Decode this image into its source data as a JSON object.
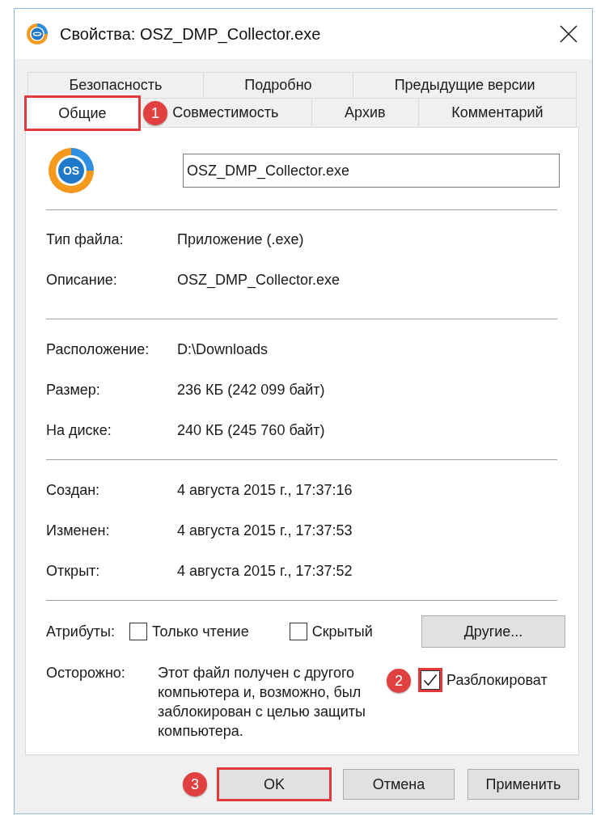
{
  "window": {
    "title": "Свойства: OSZ_DMP_Collector.exe"
  },
  "tab_rows": [
    [
      {
        "label": "Безопасность",
        "selected": false,
        "highlighted": false
      },
      {
        "label": "Подробно",
        "selected": false,
        "highlighted": false
      },
      {
        "label": "Предыдущие версии",
        "selected": false,
        "highlighted": false
      }
    ],
    [
      {
        "label": "Общие",
        "selected": true,
        "highlighted": true,
        "marker": "1"
      },
      {
        "label": "Совместимость",
        "selected": false,
        "highlighted": false
      },
      {
        "label": "Архив",
        "selected": false,
        "highlighted": false
      },
      {
        "label": "Комментарий",
        "selected": false,
        "highlighted": false
      }
    ]
  ],
  "header": {
    "icon_text": "OS",
    "file_name": "OSZ_DMP_Collector.exe"
  },
  "details": [
    [
      {
        "label": "Тип файла:",
        "value": "Приложение (.exe)"
      },
      {
        "label": "Описание:",
        "value": "OSZ_DMP_Collector.exe"
      }
    ],
    [
      {
        "label": "Расположение:",
        "value": "D:\\Downloads"
      },
      {
        "label": "Размер:",
        "value": "236 КБ (242 099 байт)"
      },
      {
        "label": "На диске:",
        "value": "240 КБ (245 760 байт)"
      }
    ],
    [
      {
        "label": "Создан:",
        "value": "4 августа 2015 г., 17:37:16"
      },
      {
        "label": "Изменен:",
        "value": "4 августа 2015 г., 17:37:53"
      },
      {
        "label": "Открыт:",
        "value": "4 августа 2015 г., 17:37:52"
      }
    ]
  ],
  "attributes": {
    "label": "Атрибуты:",
    "checkboxes": [
      {
        "label": "Только чтение",
        "checked": false
      },
      {
        "label": "Скрытый",
        "checked": false
      }
    ],
    "button": "Другие..."
  },
  "warning": {
    "label": "Осторожно:",
    "text": "Этот файл получен с другого компьютера и, возможно, был заблокирован с целью защиты компьютера.",
    "unblock": {
      "label": "Разблокироват",
      "checked": true,
      "highlighted": true,
      "marker": "2"
    }
  },
  "buttons": [
    {
      "label": "OK",
      "highlighted": true,
      "marker": "3"
    },
    {
      "label": "Отмена",
      "highlighted": false
    },
    {
      "label": "Применить",
      "highlighted": false
    }
  ]
}
